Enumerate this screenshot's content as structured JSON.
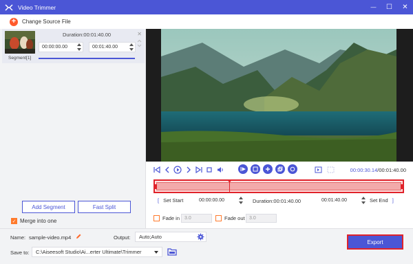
{
  "window": {
    "title": "Video Trimmer",
    "minimize_glyph": "—",
    "maximize_glyph": "☐",
    "close_glyph": "✕"
  },
  "toolbar": {
    "add_glyph": "+",
    "change_source_label": "Change Source File"
  },
  "segment": {
    "duration_label": "Duration:00:01:40.00",
    "start_time": "00:00:00.00",
    "end_time": "00:01:40.00",
    "label": "Segment[1]",
    "close_glyph": "✕"
  },
  "left_actions": {
    "add_segment_label": "Add Segment",
    "fast_split_label": "Fast Split",
    "merge_label": "Merge into one",
    "merge_checked": true
  },
  "player": {
    "current_time": "00:00:30.14",
    "total_time": "/00:01:40.00"
  },
  "trim": {
    "progress": 0.3,
    "set_start_label": "Set Start",
    "start_value": "00:00:00.00",
    "duration_label": "Duration:00:01:40.00",
    "end_value": "00:01:40.00",
    "set_end_label": "Set End"
  },
  "fade": {
    "fade_in_label": "Fade in",
    "fade_in_value": "3.0",
    "fade_out_label": "Fade out",
    "fade_out_value": "3.0"
  },
  "output": {
    "name_label": "Name:",
    "name_value": "sample-video.mp4",
    "output_label": "Output:",
    "output_value": "Auto;Auto",
    "save_label": "Save to:",
    "save_path": "C:\\Aiseesoft Studio\\Ai...erter Ultimate\\Trimmer",
    "export_label": "Export"
  },
  "colors": {
    "accent": "#4b56d6",
    "highlight": "#e0222a",
    "add_button": "#ff5a2c",
    "checkbox": "#ff7a2c"
  }
}
